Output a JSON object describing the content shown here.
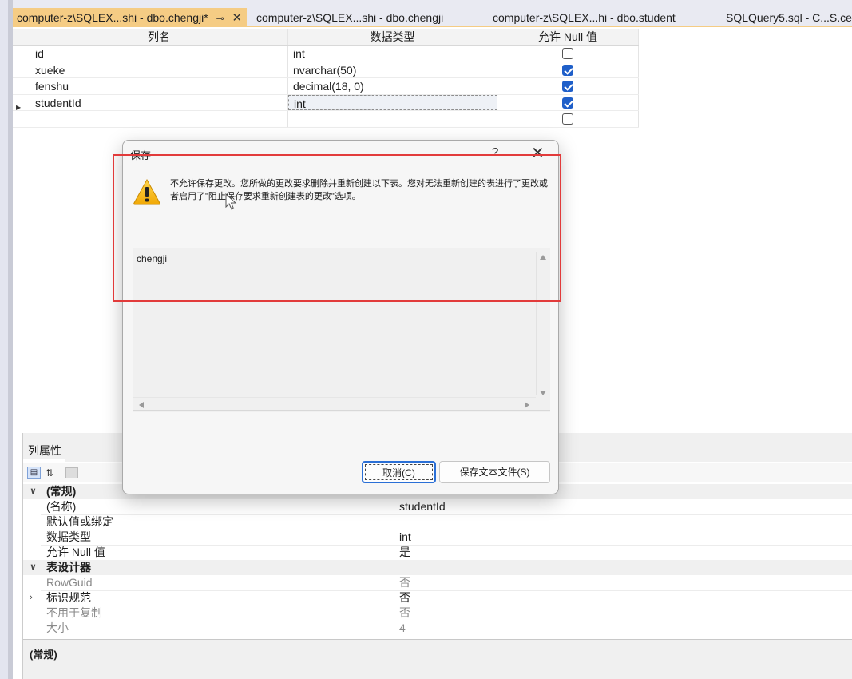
{
  "tabs": [
    {
      "label": "computer-z\\SQLEX...shi - dbo.chengji*",
      "active": true,
      "pin_icon": "pin-icon",
      "close_icon": "close-icon"
    },
    {
      "label": "computer-z\\SQLEX...shi - dbo.chengji",
      "active": false
    },
    {
      "label": "computer-z\\SQLEX...hi - dbo.student",
      "active": false
    },
    {
      "label": "SQLQuery5.sql - C...S.ces",
      "active": false
    }
  ],
  "grid": {
    "headers": {
      "column_name": "列名",
      "data_type": "数据类型",
      "allow_null": "允许 Null 值"
    },
    "rows": [
      {
        "name": "id",
        "type": "int",
        "allow_null": false
      },
      {
        "name": "xueke",
        "type": "nvarchar(50)",
        "allow_null": true
      },
      {
        "name": "fenshu",
        "type": "decimal(18, 0)",
        "allow_null": true
      },
      {
        "name": "studentId",
        "type": "int",
        "allow_null": true,
        "selected": true
      },
      {
        "name": "",
        "type": "",
        "allow_null": false
      }
    ]
  },
  "props": {
    "title": "列属性",
    "categories": [
      {
        "label": "(常规)",
        "expanded": true,
        "items": [
          {
            "name": "(名称)",
            "value": "studentId"
          },
          {
            "name": "默认值或绑定",
            "value": ""
          },
          {
            "name": "数据类型",
            "value": "int"
          },
          {
            "name": "允许 Null 值",
            "value": "是"
          }
        ]
      },
      {
        "label": "表设计器",
        "expanded": true,
        "items": [
          {
            "name": "RowGuid",
            "value": "否",
            "grey": true
          },
          {
            "name": "标识规范",
            "value": "否",
            "expandable": true
          },
          {
            "name": "不用于复制",
            "value": "否",
            "grey": true
          },
          {
            "name": "大小",
            "value": "4",
            "grey": true
          }
        ]
      }
    ],
    "description_title": "(常规)"
  },
  "dialog": {
    "title": "保存",
    "help": "?",
    "message": "不允许保存更改。您所做的更改要求删除并重新创建以下表。您对无法重新创建的表进行了更改或者启用了\"阻止保存要求重新创建表的更改\"选项。",
    "tables": [
      "chengji"
    ],
    "cancel_label": "取消(C)",
    "save_text_label": "保存文本文件(S)"
  },
  "colors": {
    "tab_active": "#f5cc84",
    "highlight": "#e23b3b",
    "checkbox_on": "#1f5fc9"
  }
}
